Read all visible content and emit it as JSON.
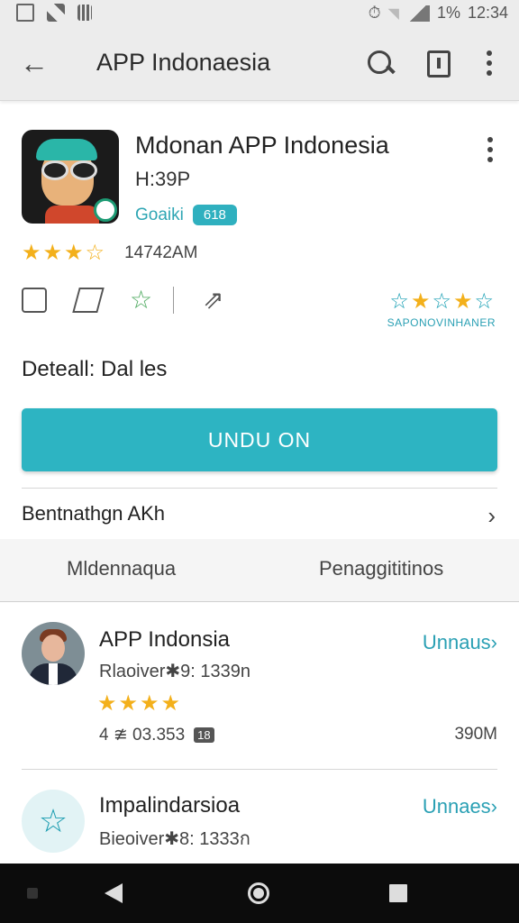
{
  "status_bar": {
    "battery": "1%",
    "time": "12:34"
  },
  "app_bar": {
    "title": "APP Indonaesia"
  },
  "app": {
    "name": "Mdonan APP Indonesia",
    "developer": "H:39P",
    "tag_label": "Goaiki",
    "badge": "618",
    "rating_stars": "★★★☆",
    "rating_count": "14742AM",
    "badge_stars_label": "SAPONOVINHANER"
  },
  "details_label": "Deteall: Dal les",
  "install_button": "UNDU ON",
  "about_label": "Bentnathgn AKh",
  "tabs": [
    "Mldennaqua",
    "Penaggititinos"
  ],
  "list": [
    {
      "title": "APP Indonsia",
      "subtitle": "Rlaoiver✱9: 1339n",
      "action": "Unnaus›",
      "stars": "★★★★",
      "meta": "4 ≇ 03.353",
      "meta_tag": "18",
      "size": "390M"
    },
    {
      "title": "Impalindarsioa",
      "subtitle": "Bieoiver✱8: 1333ก",
      "action": "Unnaes›"
    }
  ],
  "colors": {
    "accent": "#2db4c2",
    "star": "#f3b01b"
  }
}
